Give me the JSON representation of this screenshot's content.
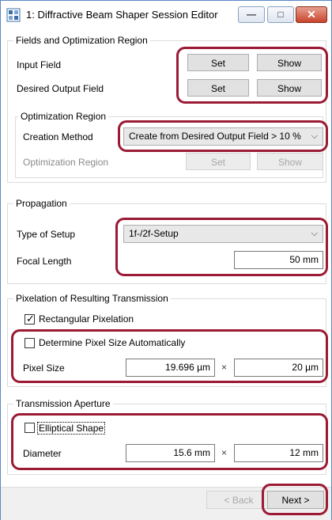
{
  "window": {
    "title": "1: Diffractive Beam Shaper Session Editor",
    "minimize_glyph": "—",
    "maximize_glyph": "□",
    "close_glyph": "✕",
    "app_icon": "session-editor-icon"
  },
  "fields_group": {
    "title": "Fields and Optimization Region",
    "input_field_label": "Input Field",
    "input_set": "Set",
    "input_show": "Show",
    "desired_label": "Desired Output Field",
    "desired_set": "Set",
    "desired_show": "Show",
    "opt_region": {
      "title": "Optimization Region",
      "creation_label": "Creation Method",
      "creation_value": "Create from Desired Output Field > 10 %",
      "region_label": "Optimization Region",
      "region_set": "Set",
      "region_show": "Show"
    }
  },
  "propagation": {
    "title": "Propagation",
    "setup_label": "Type of Setup",
    "setup_value": "1f-/2f-Setup",
    "focal_label": "Focal Length",
    "focal_value": "50 mm"
  },
  "pixelation": {
    "title": "Pixelation of Resulting Transmission",
    "rect_label": "Rectangular Pixelation",
    "rect_checked": true,
    "auto_label": "Determine Pixel Size Automatically",
    "auto_checked": false,
    "pixel_size_label": "Pixel Size",
    "pixel_x": "19.696 µm",
    "times": "×",
    "pixel_y": "20 µm"
  },
  "aperture": {
    "title": "Transmission Aperture",
    "elliptical_label": "Elliptical Shape",
    "elliptical_checked": false,
    "diameter_label": "Diameter",
    "diam_x": "15.6 mm",
    "times": "×",
    "diam_y": "12 mm"
  },
  "footer": {
    "back_label": "< Back",
    "next_label": "Next >"
  },
  "colors": {
    "highlight": "#9b1a35",
    "window_border": "#5b88c4",
    "close_button": "#c8442c"
  }
}
